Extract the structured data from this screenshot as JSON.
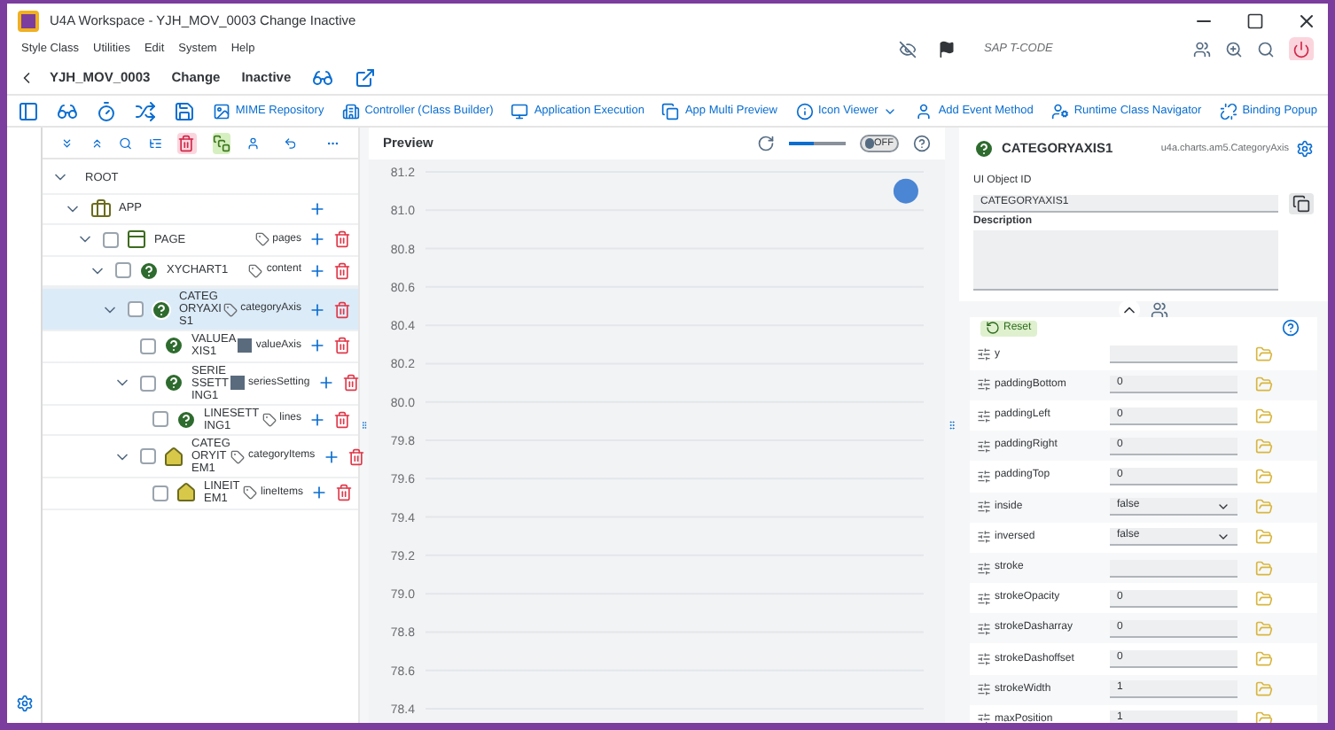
{
  "window": {
    "title": "U4A Workspace - YJH_MOV_0003 Change Inactive"
  },
  "menu": [
    "Style Class",
    "Utilities",
    "Edit",
    "System",
    "Help"
  ],
  "header": {
    "app_id": "YJH_MOV_0003",
    "mode": "Change",
    "status": "Inactive",
    "tcode_placeholder": "SAP T-CODE"
  },
  "toolbar": [
    "MIME Repository",
    "Controller (Class Builder)",
    "Application Execution",
    "App Multi Preview",
    "Icon Viewer",
    "Add Event Method",
    "Runtime Class Navigator",
    "Binding Popup"
  ],
  "tree": {
    "nodes": [
      {
        "label": "ROOT",
        "kind": "root",
        "expanded": true,
        "selected": false,
        "children": [
          {
            "label": "APP",
            "kind": "app",
            "expanded": true,
            "selected": false,
            "children": [
              {
                "label": "PAGE",
                "kind": "page",
                "checked": false,
                "binding": {
                  "label": "pages",
                  "kind": "tag"
                },
                "expanded": true,
                "selected": false,
                "children": [
                  {
                    "label": "XYCHART1",
                    "kind": "control",
                    "checked": false,
                    "binding": {
                      "label": "content",
                      "kind": "tag"
                    },
                    "expanded": true,
                    "selected": false,
                    "children": [
                      {
                        "label": "CATEGORYAXIS1",
                        "kind": "control",
                        "checked": false,
                        "binding": {
                          "label": "categoryAxis",
                          "kind": "tag"
                        },
                        "expanded": true,
                        "selected": true,
                        "children": [
                          {
                            "label": "VALUEAXIS1",
                            "kind": "control",
                            "checked": false,
                            "binding": {
                              "label": "valueAxis",
                              "kind": "block"
                            },
                            "selected": false
                          },
                          {
                            "label": "SERIESSETTING1",
                            "kind": "control",
                            "checked": false,
                            "binding": {
                              "label": "seriesSetting",
                              "kind": "block"
                            },
                            "expanded": true,
                            "selected": false,
                            "children": [
                              {
                                "label": "LINESETTING1",
                                "kind": "control",
                                "checked": false,
                                "binding": {
                                  "label": "lines",
                                  "kind": "tag"
                                },
                                "selected": false
                              }
                            ]
                          },
                          {
                            "label": "CATEGORYITEM1",
                            "kind": "item",
                            "checked": false,
                            "binding": {
                              "label": "categoryItems",
                              "kind": "tag"
                            },
                            "expanded": true,
                            "selected": false,
                            "children": [
                              {
                                "label": "LINEITEM1",
                                "kind": "item",
                                "checked": false,
                                "binding": {
                                  "label": "lineItems",
                                  "kind": "tag"
                                },
                                "selected": false
                              }
                            ]
                          }
                        ]
                      }
                    ]
                  }
                ]
              }
            ]
          }
        ]
      }
    ]
  },
  "preview": {
    "title": "Preview",
    "zoom": {
      "level": 0.45
    },
    "toggle": {
      "label": "OFF",
      "on": false
    },
    "chart_data": {
      "type": "scatter",
      "grid": true,
      "categories": [
        null,
        null,
        null,
        null,
        null,
        null,
        null,
        null,
        null,
        null,
        null,
        null,
        null,
        null
      ],
      "series": [
        {
          "color": "#4a86d4",
          "values": [
            null,
            null,
            null,
            null,
            null,
            null,
            null,
            null,
            null,
            null,
            null,
            null,
            null,
            81.1
          ]
        }
      ],
      "ylim": [
        78.4,
        81.2
      ],
      "yticks": [
        {
          "value": 81.2,
          "label": "81.2"
        },
        {
          "value": 81.0,
          "label": "81.0"
        },
        {
          "value": 80.8,
          "label": "80.8"
        },
        {
          "value": 80.6,
          "label": "80.6"
        },
        {
          "value": 80.4,
          "label": "80.4"
        },
        {
          "value": 80.2,
          "label": "80.2"
        },
        {
          "value": 80.0,
          "label": "80.0"
        },
        {
          "value": 79.8,
          "label": "79.8"
        },
        {
          "value": 79.6,
          "label": "79.6"
        },
        {
          "value": 79.4,
          "label": "79.4"
        },
        {
          "value": 79.2,
          "label": "79.2"
        },
        {
          "value": 79.0,
          "label": "79.0"
        },
        {
          "value": 78.8,
          "label": "78.8"
        },
        {
          "value": 78.6,
          "label": "78.6"
        },
        {
          "value": 78.4,
          "label": "78.4"
        }
      ]
    }
  },
  "inspector": {
    "title": "CATEGORYAXIS1",
    "class_name": "u4a.charts.am5.CategoryAxis",
    "id_label": "UI Object ID",
    "id_value": "CATEGORYAXIS1",
    "description_label": "Description",
    "reset": "Reset",
    "properties": [
      {
        "name": "y",
        "kind": "input"
      },
      {
        "name": "paddingBottom",
        "value": "0",
        "kind": "input"
      },
      {
        "name": "paddingLeft",
        "value": "0",
        "kind": "input"
      },
      {
        "name": "paddingRight",
        "value": "0",
        "kind": "input"
      },
      {
        "name": "paddingTop",
        "value": "0",
        "kind": "input"
      },
      {
        "name": "inside",
        "value": "false",
        "kind": "select"
      },
      {
        "name": "inversed",
        "value": "false",
        "kind": "select"
      },
      {
        "name": "stroke",
        "kind": "input"
      },
      {
        "name": "strokeOpacity",
        "value": "0",
        "kind": "input"
      },
      {
        "name": "strokeDasharray",
        "value": "0",
        "kind": "input"
      },
      {
        "name": "strokeDashoffset",
        "value": "0",
        "kind": "input"
      },
      {
        "name": "strokeWidth",
        "value": "1",
        "kind": "input"
      },
      {
        "name": "maxPosition",
        "value": "1",
        "kind": "input"
      }
    ]
  }
}
